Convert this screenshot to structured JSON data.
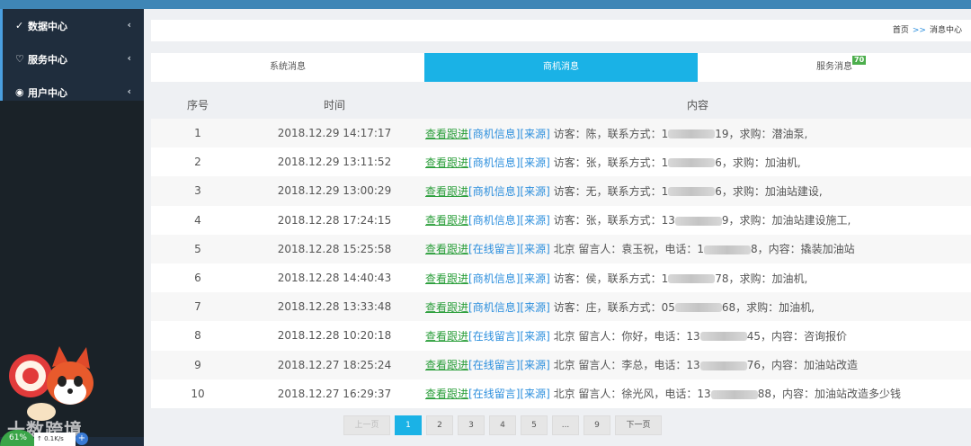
{
  "sidebar": {
    "items": [
      {
        "label": "数据中心",
        "icon": "check-icon",
        "glyph": "✓"
      },
      {
        "label": "服务中心",
        "icon": "heart-icon",
        "glyph": "♡"
      },
      {
        "label": "用户中心",
        "icon": "user-circle-icon",
        "glyph": "◉"
      }
    ],
    "chevron": "‹"
  },
  "overlay": {
    "watermark": "十数跨境",
    "ball_percent": "61%",
    "ball_speed": "↑ 0.1K/s",
    "plus": "+"
  },
  "breadcrumb": {
    "home": "首页",
    "sep": ">>",
    "current": "消息中心"
  },
  "tabs": [
    {
      "label": "系统消息",
      "active": false,
      "badge": ""
    },
    {
      "label": "商机消息",
      "active": true,
      "badge": ""
    },
    {
      "label": "服务消息",
      "active": false,
      "badge": "70"
    }
  ],
  "table": {
    "headers": {
      "idx": "序号",
      "time": "时间",
      "content": "内容"
    },
    "rows": [
      {
        "idx": "1",
        "time": "2018.12.29 14:17:17",
        "link": "查看跟进",
        "tag": "[商机信息]",
        "src": "[来源]",
        "pre": "访客：陈，联系方式：1",
        "post": "19，求购：潜油泵,"
      },
      {
        "idx": "2",
        "time": "2018.12.29 13:11:52",
        "link": "查看跟进",
        "tag": "[商机信息]",
        "src": "[来源]",
        "pre": "访客：张，联系方式：1",
        "post": "6，求购：加油机,"
      },
      {
        "idx": "3",
        "time": "2018.12.29 13:00:29",
        "link": "查看跟进",
        "tag": "[商机信息]",
        "src": "[来源]",
        "pre": "访客：无，联系方式：1",
        "post": "6，求购：加油站建设,"
      },
      {
        "idx": "4",
        "time": "2018.12.28 17:24:15",
        "link": "查看跟进",
        "tag": "[商机信息]",
        "src": "[来源]",
        "pre": "访客：张，联系方式：13",
        "post": "9，求购：加油站建设施工,"
      },
      {
        "idx": "5",
        "time": "2018.12.28 15:25:58",
        "link": "查看跟进",
        "tag": "[在线留言]",
        "src": "[来源]",
        "pre": "北京 留言人：袁玉祝，电话：1",
        "post": "8，内容：撬装加油站"
      },
      {
        "idx": "6",
        "time": "2018.12.28 14:40:43",
        "link": "查看跟进",
        "tag": "[商机信息]",
        "src": "[来源]",
        "pre": "访客：侯，联系方式：1",
        "post": "78，求购：加油机,"
      },
      {
        "idx": "7",
        "time": "2018.12.28 13:33:48",
        "link": "查看跟进",
        "tag": "[商机信息]",
        "src": "[来源]",
        "pre": "访客：庄，联系方式：05",
        "post": "68，求购：加油机,"
      },
      {
        "idx": "8",
        "time": "2018.12.28 10:20:18",
        "link": "查看跟进",
        "tag": "[在线留言]",
        "src": "[来源]",
        "pre": "北京 留言人：你好，电话：13",
        "post": "45，内容：咨询报价"
      },
      {
        "idx": "9",
        "time": "2018.12.27 18:25:24",
        "link": "查看跟进",
        "tag": "[在线留言]",
        "src": "[来源]",
        "pre": "北京 留言人：李总，电话：13",
        "post": "76，内容：加油站改造"
      },
      {
        "idx": "10",
        "time": "2018.12.27 16:29:37",
        "link": "查看跟进",
        "tag": "[在线留言]",
        "src": "[来源]",
        "pre": "北京 留言人：徐光风，电话：13",
        "post": "88，内容：加油站改造多少钱"
      }
    ]
  },
  "pager": {
    "prev": "上一页",
    "pages": [
      "1",
      "2",
      "3",
      "4",
      "5",
      "...",
      "9"
    ],
    "current": "1",
    "next": "下一页"
  },
  "colors": {
    "sidebar_bg": "#1f2d3d",
    "active_tab": "#1ab2e6",
    "link_green": "#2a9e3a",
    "link_blue": "#2d8fdd",
    "badge_green": "#4cae4c"
  }
}
